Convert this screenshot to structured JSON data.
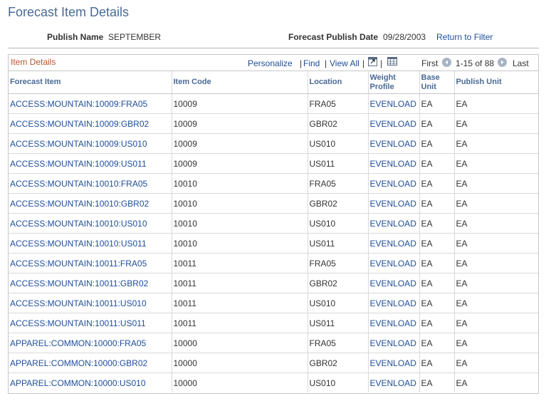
{
  "page": {
    "title": "Forecast Item Details"
  },
  "publish": {
    "name_label": "Publish Name",
    "name_value": "SEPTEMBER",
    "date_label": "Forecast Publish Date",
    "date_value": "09/28/2003",
    "return_link": "Return to Filter"
  },
  "grid": {
    "title": "Item Details",
    "personalize": "Personalize",
    "find": "Find",
    "view_all": "View All",
    "separator": "|",
    "first": "First",
    "range": "1-15 of 88",
    "last": "Last",
    "columns": [
      "Forecast Item",
      "Item Code",
      "Location",
      "Weight Profile",
      "Base Unit",
      "Publish Unit"
    ],
    "rows": [
      {
        "item": "ACCESS:MOUNTAIN:10009:FRA05",
        "code": "10009",
        "location": "FRA05",
        "weight": "EVENLOAD",
        "base": "EA",
        "publish": "EA"
      },
      {
        "item": "ACCESS:MOUNTAIN:10009:GBR02",
        "code": "10009",
        "location": "GBR02",
        "weight": "EVENLOAD",
        "base": "EA",
        "publish": "EA"
      },
      {
        "item": "ACCESS:MOUNTAIN:10009:US010",
        "code": "10009",
        "location": "US010",
        "weight": "EVENLOAD",
        "base": "EA",
        "publish": "EA"
      },
      {
        "item": "ACCESS:MOUNTAIN:10009:US011",
        "code": "10009",
        "location": "US011",
        "weight": "EVENLOAD",
        "base": "EA",
        "publish": "EA"
      },
      {
        "item": "ACCESS:MOUNTAIN:10010:FRA05",
        "code": "10010",
        "location": "FRA05",
        "weight": "EVENLOAD",
        "base": "EA",
        "publish": "EA"
      },
      {
        "item": "ACCESS:MOUNTAIN:10010:GBR02",
        "code": "10010",
        "location": "GBR02",
        "weight": "EVENLOAD",
        "base": "EA",
        "publish": "EA"
      },
      {
        "item": "ACCESS:MOUNTAIN:10010:US010",
        "code": "10010",
        "location": "US010",
        "weight": "EVENLOAD",
        "base": "EA",
        "publish": "EA"
      },
      {
        "item": "ACCESS:MOUNTAIN:10010:US011",
        "code": "10010",
        "location": "US011",
        "weight": "EVENLOAD",
        "base": "EA",
        "publish": "EA"
      },
      {
        "item": "ACCESS:MOUNTAIN:10011:FRA05",
        "code": "10011",
        "location": "FRA05",
        "weight": "EVENLOAD",
        "base": "EA",
        "publish": "EA"
      },
      {
        "item": "ACCESS:MOUNTAIN:10011:GBR02",
        "code": "10011",
        "location": "GBR02",
        "weight": "EVENLOAD",
        "base": "EA",
        "publish": "EA"
      },
      {
        "item": "ACCESS:MOUNTAIN:10011:US010",
        "code": "10011",
        "location": "US010",
        "weight": "EVENLOAD",
        "base": "EA",
        "publish": "EA"
      },
      {
        "item": "ACCESS:MOUNTAIN:10011:US011",
        "code": "10011",
        "location": "US011",
        "weight": "EVENLOAD",
        "base": "EA",
        "publish": "EA"
      },
      {
        "item": "APPAREL:COMMON:10000:FRA05",
        "code": "10000",
        "location": "FRA05",
        "weight": "EVENLOAD",
        "base": "EA",
        "publish": "EA"
      },
      {
        "item": "APPAREL:COMMON:10000:GBR02",
        "code": "10000",
        "location": "GBR02",
        "weight": "EVENLOAD",
        "base": "EA",
        "publish": "EA"
      },
      {
        "item": "APPAREL:COMMON:10000:US010",
        "code": "10000",
        "location": "US010",
        "weight": "EVENLOAD",
        "base": "EA",
        "publish": "EA"
      }
    ]
  },
  "icons": {
    "zoom": "new-window-icon",
    "download": "spreadsheet-icon",
    "prev": "previous-arrow-icon",
    "next": "next-arrow-icon"
  },
  "colors": {
    "link": "#1e4d9b",
    "title": "#4a6a96",
    "grid_title": "#b6572b"
  }
}
